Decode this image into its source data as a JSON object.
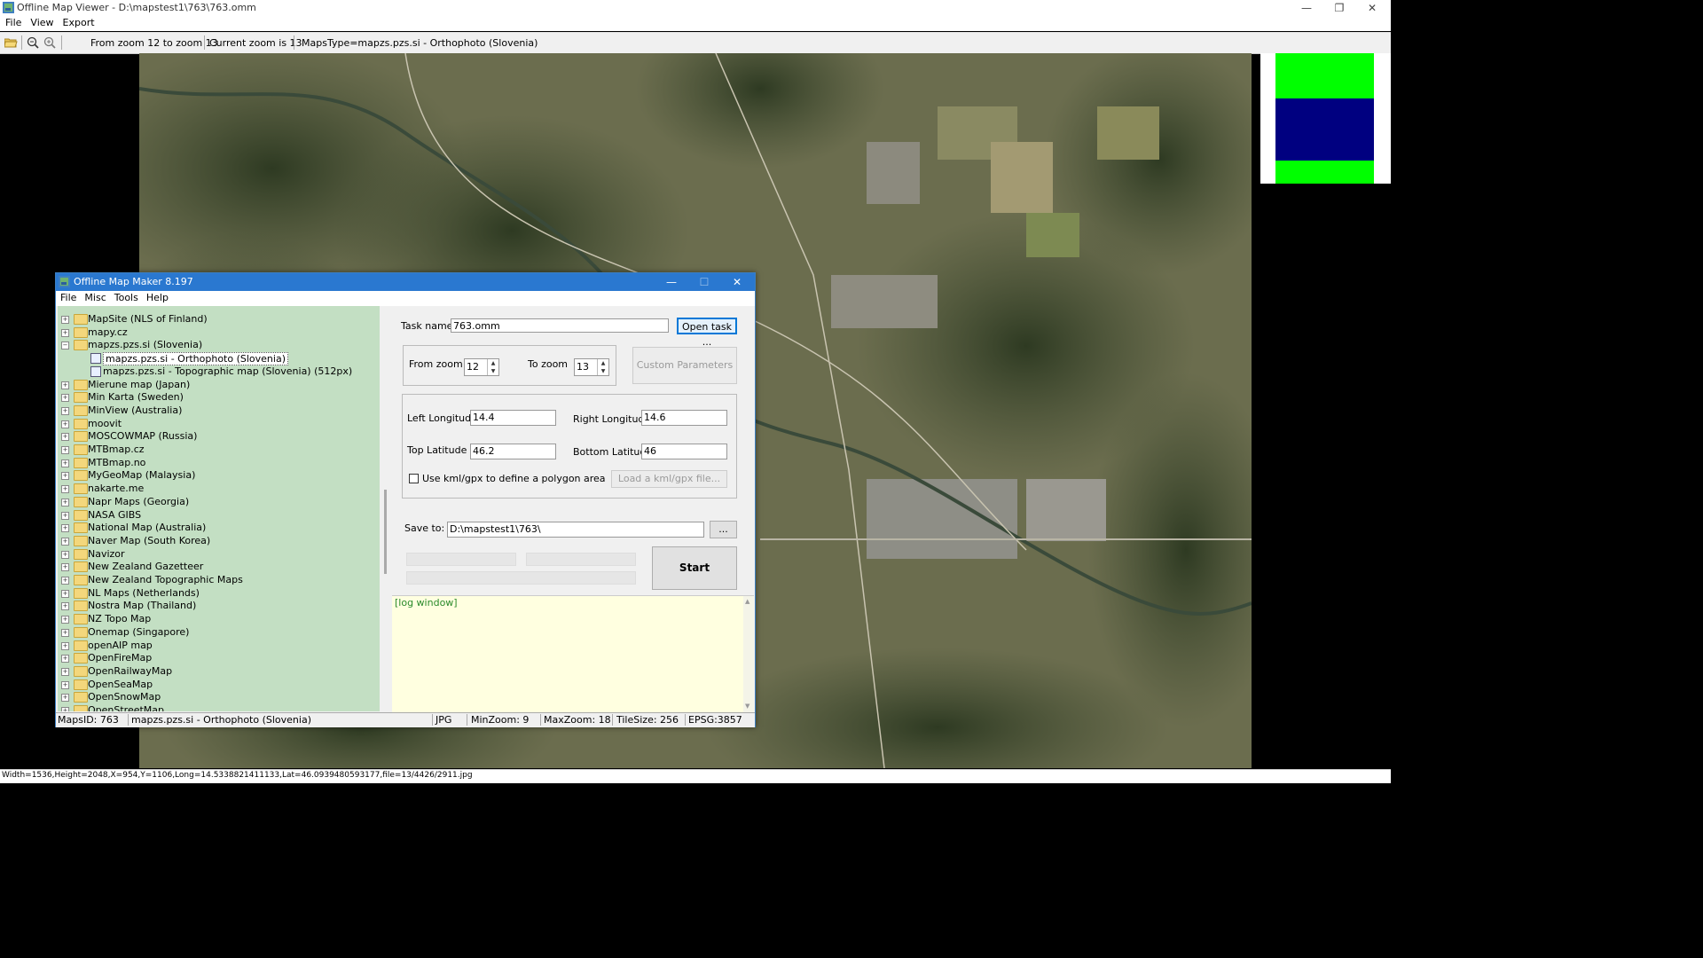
{
  "window": {
    "title": "Offline Map Viewer - D:\\mapstest1\\763\\763.omm"
  },
  "menu": [
    "File",
    "View",
    "Export"
  ],
  "toolbar": {
    "zoom_range": "From zoom 12 to zoom 13",
    "current_zoom": "Current zoom is 13",
    "maps_type": "MapsType=mapzs.pzs.si - Orthophoto (Slovenia)"
  },
  "minimap": {
    "colors": [
      "#00ff00",
      "#000080",
      "#00ff00"
    ]
  },
  "status_bar": "Width=1536,Height=2048,X=954,Y=1106,Long=14.5338821411133,Lat=46.0939480593177,file=13/4426/2911.jpg",
  "dialog": {
    "title": "Offline Map Maker 8.197",
    "menu": [
      "File",
      "Misc",
      "Tools",
      "Help"
    ],
    "tree": [
      {
        "label": "MapSite (NLS of Finland)",
        "level": 0,
        "expanded": false
      },
      {
        "label": "mapy.cz",
        "level": 0,
        "expanded": false
      },
      {
        "label": "mapzs.pzs.si (Slovenia)",
        "level": 0,
        "expanded": true
      },
      {
        "label": "mapzs.pzs.si - Orthophoto (Slovenia)",
        "level": 1,
        "selected": true
      },
      {
        "label": "mapzs.pzs.si - Topographic map (Slovenia) (512px)",
        "level": 1
      },
      {
        "label": "Mierune map (Japan)",
        "level": 0,
        "expanded": false
      },
      {
        "label": "Min Karta (Sweden)",
        "level": 0,
        "expanded": false
      },
      {
        "label": "MinView (Australia)",
        "level": 0,
        "expanded": false
      },
      {
        "label": "moovit",
        "level": 0,
        "expanded": false
      },
      {
        "label": "MOSCOWMAP (Russia)",
        "level": 0,
        "expanded": false
      },
      {
        "label": "MTBmap.cz",
        "level": 0,
        "expanded": false
      },
      {
        "label": "MTBmap.no",
        "level": 0,
        "expanded": false
      },
      {
        "label": "MyGeoMap (Malaysia)",
        "level": 0,
        "expanded": false
      },
      {
        "label": "nakarte.me",
        "level": 0,
        "expanded": false
      },
      {
        "label": "Napr Maps (Georgia)",
        "level": 0,
        "expanded": false
      },
      {
        "label": "NASA GIBS",
        "level": 0,
        "expanded": false
      },
      {
        "label": "National Map (Australia)",
        "level": 0,
        "expanded": false
      },
      {
        "label": "Naver Map (South Korea)",
        "level": 0,
        "expanded": false
      },
      {
        "label": "Navizor",
        "level": 0,
        "expanded": false
      },
      {
        "label": "New Zealand Gazetteer",
        "level": 0,
        "expanded": false
      },
      {
        "label": "New Zealand Topographic Maps",
        "level": 0,
        "expanded": false
      },
      {
        "label": "NL Maps (Netherlands)",
        "level": 0,
        "expanded": false
      },
      {
        "label": "Nostra Map (Thailand)",
        "level": 0,
        "expanded": false
      },
      {
        "label": "NZ Topo Map",
        "level": 0,
        "expanded": false
      },
      {
        "label": "Onemap (Singapore)",
        "level": 0,
        "expanded": false
      },
      {
        "label": "openAIP map",
        "level": 0,
        "expanded": false
      },
      {
        "label": "OpenFireMap",
        "level": 0,
        "expanded": false
      },
      {
        "label": "OpenRailwayMap",
        "level": 0,
        "expanded": false
      },
      {
        "label": "OpenSeaMap",
        "level": 0,
        "expanded": false
      },
      {
        "label": "OpenSnowMap",
        "level": 0,
        "expanded": false
      },
      {
        "label": "OpenStreetMap",
        "level": 0,
        "expanded": false
      }
    ],
    "task_name_label": "Task name",
    "task_name_value": "763.omm",
    "open_task_button": "Open task ...",
    "from_zoom_label": "From zoom",
    "from_zoom_value": "12",
    "to_zoom_label": "To zoom",
    "to_zoom_value": "13",
    "custom_params_button": "Custom Parameters",
    "left_longitude_label": "Left Longitude",
    "left_longitude_value": "14.4",
    "right_longitude_label": "Right Longitude",
    "right_longitude_value": "14.6",
    "top_latitude_label": "Top Latitude",
    "top_latitude_value": "46.2",
    "bottom_latitude_label": "Bottom Latitude",
    "bottom_latitude_value": "46",
    "kml_checkbox_label": "Use kml/gpx to define a polygon area",
    "load_kml_button": "Load a kml/gpx file...",
    "save_to_label": "Save to:",
    "save_to_value": "D:\\mapstest1\\763\\",
    "browse_button": "...",
    "start_button": "Start",
    "log_text": "[log window]",
    "status": {
      "maps_id": "MapsID: 763",
      "maps_name": "mapzs.pzs.si - Orthophoto (Slovenia)",
      "format": "JPG",
      "min_zoom": "MinZoom: 9",
      "max_zoom": "MaxZoom: 18",
      "tile_size": "TileSize: 256",
      "epsg": "EPSG:3857"
    }
  }
}
